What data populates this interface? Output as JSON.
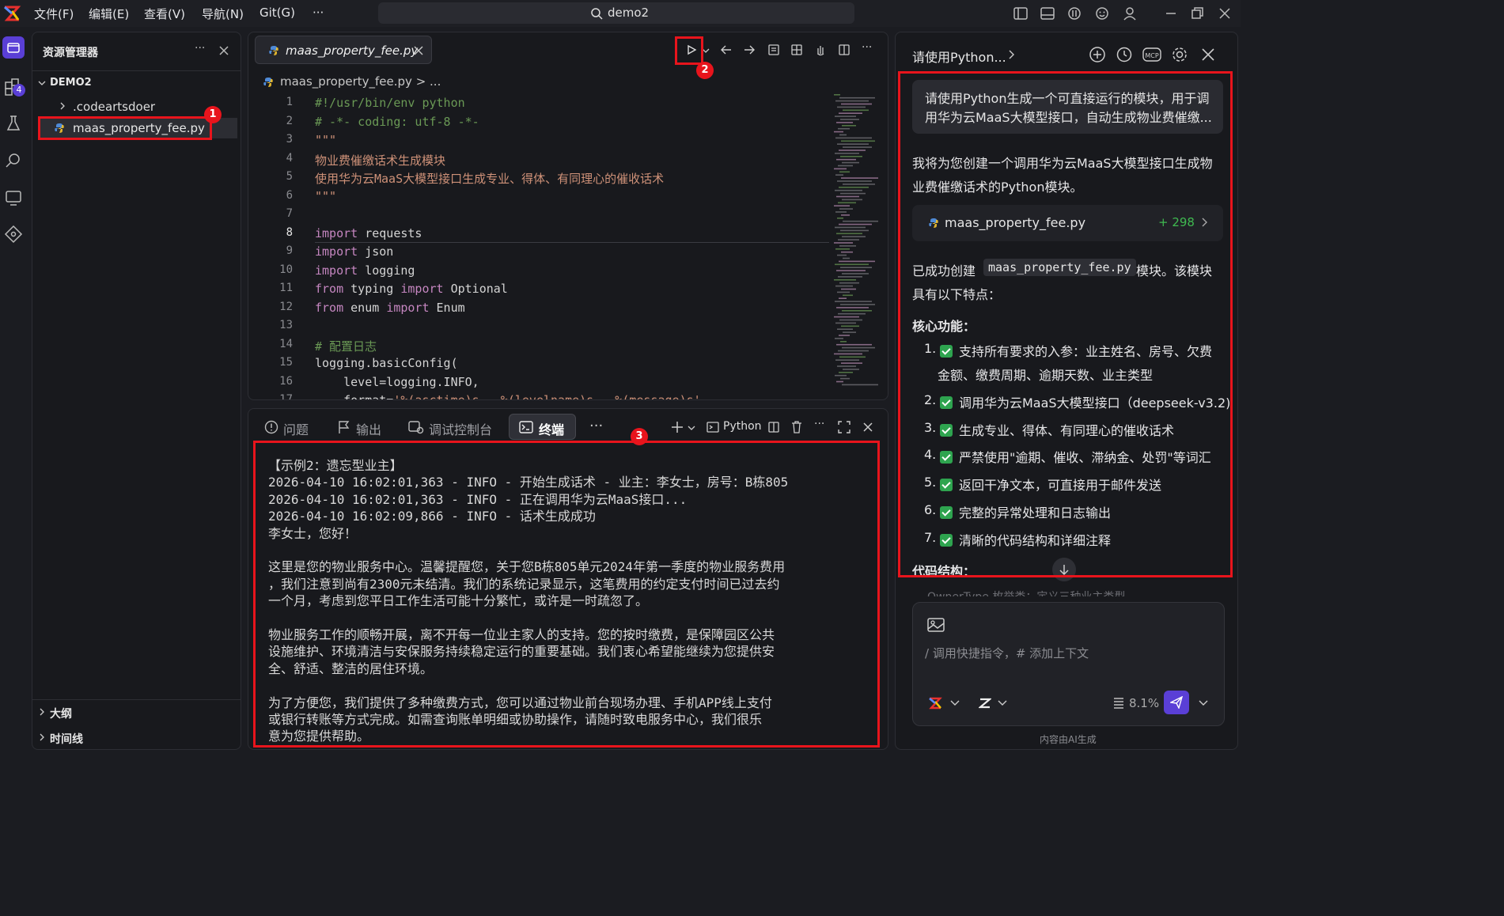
{
  "menu": {
    "file": "文件(F)",
    "edit": "编辑(E)",
    "view": "查看(V)",
    "nav": "导航(N)",
    "git": "Git(G)",
    "more": "···"
  },
  "search": {
    "label": "demo2"
  },
  "explorer": {
    "title": "资源管理器",
    "more": "···",
    "project": "DEMO2",
    "folder": ".codeartsdoer",
    "file": "maas_property_fee.py",
    "outline": "大纲",
    "timeline": "时间线"
  },
  "activity": {
    "badge": "4"
  },
  "editor": {
    "tab": "maas_property_fee.py",
    "breadcrumb": "maas_property_fee.py > ...",
    "lines": [
      {
        "n": "1",
        "parts": [
          [
            "cm",
            "#!/usr/bin/env python"
          ]
        ]
      },
      {
        "n": "2",
        "parts": [
          [
            "cm",
            "# -*- coding: utf-8 -*-"
          ]
        ]
      },
      {
        "n": "3",
        "parts": [
          [
            "str",
            "\"\"\""
          ]
        ]
      },
      {
        "n": "4",
        "parts": [
          [
            "str",
            "物业费催缴话术生成模块"
          ]
        ]
      },
      {
        "n": "5",
        "parts": [
          [
            "str",
            "使用华为云MaaS大模型接口生成专业、得体、有同理心的催收话术"
          ]
        ]
      },
      {
        "n": "6",
        "parts": [
          [
            "str",
            "\"\"\""
          ]
        ]
      },
      {
        "n": "7",
        "parts": [
          [
            "",
            ""
          ]
        ]
      },
      {
        "n": "8",
        "parts": [
          [
            "kw",
            "import"
          ],
          [
            "",
            " requests"
          ]
        ]
      },
      {
        "n": "9",
        "parts": [
          [
            "kw",
            "import"
          ],
          [
            "",
            " json"
          ]
        ]
      },
      {
        "n": "10",
        "parts": [
          [
            "kw",
            "import"
          ],
          [
            "",
            " logging"
          ]
        ]
      },
      {
        "n": "11",
        "parts": [
          [
            "kw",
            "from"
          ],
          [
            "",
            " typing "
          ],
          [
            "kw",
            "import"
          ],
          [
            "",
            " Optional"
          ]
        ]
      },
      {
        "n": "12",
        "parts": [
          [
            "kw",
            "from"
          ],
          [
            "",
            " enum "
          ],
          [
            "kw",
            "import"
          ],
          [
            "",
            " Enum"
          ]
        ]
      },
      {
        "n": "13",
        "parts": [
          [
            "",
            ""
          ]
        ]
      },
      {
        "n": "14",
        "parts": [
          [
            "cm",
            "# 配置日志"
          ]
        ]
      },
      {
        "n": "15",
        "parts": [
          [
            "",
            "logging.basicConfig("
          ]
        ]
      },
      {
        "n": "16",
        "parts": [
          [
            "",
            "    level=logging.INFO,"
          ]
        ]
      },
      {
        "n": "17",
        "parts": [
          [
            "",
            "    format="
          ],
          [
            "str",
            "'%(asctime)s - %(levelname)s - %(message)s'"
          ]
        ]
      }
    ]
  },
  "terminal": {
    "tabs": {
      "problems": "问题",
      "output": "输出",
      "debug": "调试控制台",
      "terminal": "终端",
      "more": "···"
    },
    "shell": "Python",
    "lines": [
      "【示例2：遗忘型业主】",
      "2026-04-10 16:02:01,363 - INFO - 开始生成话术 - 业主：李女士，房号：B栋805",
      "2026-04-10 16:02:01,363 - INFO - 正在调用华为云MaaS接口...",
      "2026-04-10 16:02:09,866 - INFO - 话术生成成功",
      "李女士，您好！",
      "",
      "这里是您的物业服务中心。温馨提醒您，关于您B栋805单元2024年第一季度的物业服务费用",
      "，我们注意到尚有2300元未结清。我们的系统记录显示，这笔费用的约定支付时间已过去约",
      "一个月，考虑到您平日工作生活可能十分繁忙，或许是一时疏忽了。",
      "",
      "物业服务工作的顺畅开展，离不开每一位业主家人的支持。您的按时缴费，是保障园区公共",
      "设施维护、环境清洁与安保服务持续稳定运行的重要基础。我们衷心希望能继续为您提供安",
      "全、舒适、整洁的居住环境。",
      "",
      "为了方便您，我们提供了多种缴费方式，您可以通过物业前台现场办理、手机APP线上支付",
      "或银行转账等方式完成。如需查询账单明细或协助操作，请随时致电服务中心，我们很乐",
      "意为您提供帮助。"
    ]
  },
  "chat": {
    "title": "请使用Python...",
    "user_msg_1": "请使用Python生成一个可直接运行的模块，用于调",
    "user_msg_2": "用华为云MaaS大模型接口，自动生成物业费催缴...",
    "reply_1": "我将为您创建一个调用华为云MaaS大模型接口生成物",
    "reply_2": "业费催缴话术的Python模块。",
    "file_card": "maas_property_fee.py",
    "file_delta": "+ 298",
    "created_a": "已成功创建",
    "created_code": "maas_property_fee.py",
    "created_b": "模块。该模块",
    "created_c": "具有以下特点：",
    "core_title": "核心功能：",
    "features": [
      {
        "n": "1.",
        "t": "支持所有要求的入参：业主姓名、房号、欠费",
        "t2": "金额、缴费周期、逾期天数、业主类型"
      },
      {
        "n": "2.",
        "t": "调用华为云MaaS大模型接口（deepseek-v3.2)",
        "t2": ""
      },
      {
        "n": "3.",
        "t": "生成专业、得体、有同理心的催收话术",
        "t2": ""
      },
      {
        "n": "4.",
        "t": "严禁使用\"逾期、催收、滞纳金、处罚\"等词汇",
        "t2": ""
      },
      {
        "n": "5.",
        "t": "返回干净文本，可直接用于邮件发送",
        "t2": ""
      },
      {
        "n": "6.",
        "t": "完整的异常处理和日志输出",
        "t2": ""
      },
      {
        "n": "7.",
        "t": "清晰的代码结构和详细注释",
        "t2": ""
      }
    ],
    "structure_title": "代码结构：",
    "hidden_line": "OwnerType 枚举类：定义三种业主类型",
    "input_placeholder": "/ 调用快捷指令，# 添加上下文",
    "context_pct": "8.1%",
    "footer": "内容由AI生成"
  },
  "annotations": {
    "a1": "1",
    "a2": "2",
    "a3": "3"
  }
}
